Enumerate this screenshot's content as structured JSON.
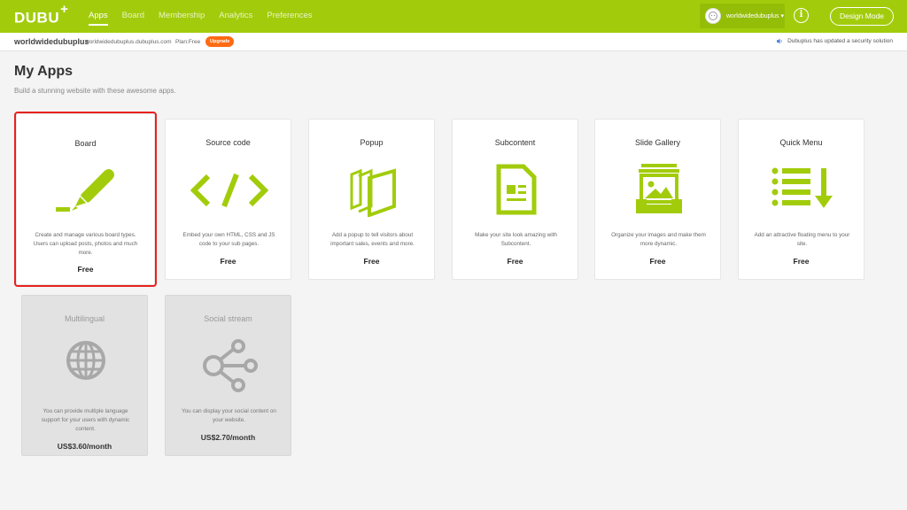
{
  "header": {
    "logo": "DUBU",
    "logo_plus": "+",
    "nav": [
      "Apps",
      "Board",
      "Membership",
      "Analytics",
      "Preferences"
    ],
    "username": "worldwidedubuplus ▾",
    "info_icon": "i",
    "design_mode": "Design Mode"
  },
  "subbar": {
    "site_name": "worldwidedubuplus",
    "site_url": "worldwidedubuplus.dubuplus.com",
    "plan": "Plan:Free",
    "upgrade": "Upgrade",
    "notice": "Dubuplus has updated a security solution"
  },
  "page": {
    "title": "My Apps",
    "subtitle": "Build a stunning website with these awesome apps."
  },
  "apps": [
    {
      "title": "Board",
      "icon": "pen-icon",
      "desc": "Create and manage various board types. Users can upload posts, photos and much more.",
      "price": "Free",
      "disabled": false,
      "selected": true
    },
    {
      "title": "Source code",
      "icon": "code-icon",
      "desc": "Embed your own HTML, CSS and JS code to your sub pages.",
      "price": "Free",
      "disabled": false
    },
    {
      "title": "Popup",
      "icon": "popup-icon",
      "desc": "Add a popup to tell visitors about important sales, events and more.",
      "price": "Free",
      "disabled": false
    },
    {
      "title": "Subcontent",
      "icon": "document-icon",
      "desc": "Make your site look amazing with Subcontent.",
      "price": "Free",
      "disabled": false
    },
    {
      "title": "Slide Gallery",
      "icon": "gallery-icon",
      "desc": "Organize your images and make them more dynamic.",
      "price": "Free",
      "disabled": false
    },
    {
      "title": "Quick Menu",
      "icon": "quick-menu-icon",
      "desc": "Add an attractive floating menu to your site.",
      "price": "Free",
      "disabled": false
    },
    {
      "title": "Multilingual",
      "icon": "globe-icon",
      "desc": "You can provide multiple language support for your users with dynamic content.",
      "price": "US$3.60/month",
      "disabled": true
    },
    {
      "title": "Social stream",
      "icon": "share-icon",
      "desc": "You can display your social content on your website.",
      "price": "US$2.70/month",
      "disabled": true
    }
  ],
  "colors": {
    "brand": "#a2cc0b",
    "upgrade": "#ff6a13",
    "selection": "#e8211f",
    "disabled_icon": "#a8a8a8"
  }
}
